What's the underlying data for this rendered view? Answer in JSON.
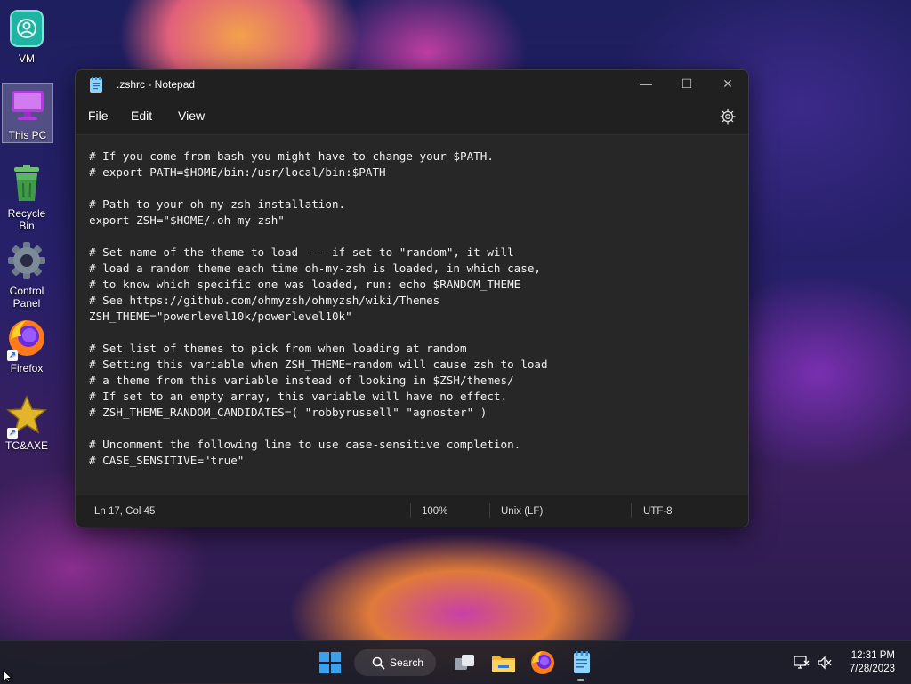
{
  "desktop": {
    "icons": [
      {
        "label": "VM"
      },
      {
        "label": "This PC"
      },
      {
        "label": "Recycle Bin"
      },
      {
        "label": "Control Panel"
      },
      {
        "label": "Firefox"
      },
      {
        "label": "TC&AXE"
      }
    ]
  },
  "window": {
    "title": ".zshrc - Notepad",
    "controls": {
      "minimize": "—",
      "maximize": "☐",
      "close": "✕"
    },
    "menu": {
      "file": "File",
      "edit": "Edit",
      "view": "View"
    },
    "settings_icon": "gear-icon",
    "content": "# If you come from bash you might have to change your $PATH.\n# export PATH=$HOME/bin:/usr/local/bin:$PATH\n\n# Path to your oh-my-zsh installation.\nexport ZSH=\"$HOME/.oh-my-zsh\"\n\n# Set name of the theme to load --- if set to \"random\", it will\n# load a random theme each time oh-my-zsh is loaded, in which case,\n# to know which specific one was loaded, run: echo $RANDOM_THEME\n# See https://github.com/ohmyzsh/ohmyzsh/wiki/Themes\nZSH_THEME=\"powerlevel10k/powerlevel10k\"\n\n# Set list of themes to pick from when loading at random\n# Setting this variable when ZSH_THEME=random will cause zsh to load\n# a theme from this variable instead of looking in $ZSH/themes/\n# If set to an empty array, this variable will have no effect.\n# ZSH_THEME_RANDOM_CANDIDATES=( \"robbyrussell\" \"agnoster\" )\n\n# Uncomment the following line to use case-sensitive completion.\n# CASE_SENSITIVE=\"true\"",
    "status": {
      "position": "Ln 17, Col 45",
      "zoom": "100%",
      "line_ending": "Unix (LF)",
      "encoding": "UTF-8"
    }
  },
  "taskbar": {
    "search_label": "Search",
    "time": "12:31 PM",
    "date": "7/28/2023"
  },
  "colors": {
    "window_bg": "#202020",
    "editor_bg": "#272727",
    "text": "#f0f0f0"
  }
}
